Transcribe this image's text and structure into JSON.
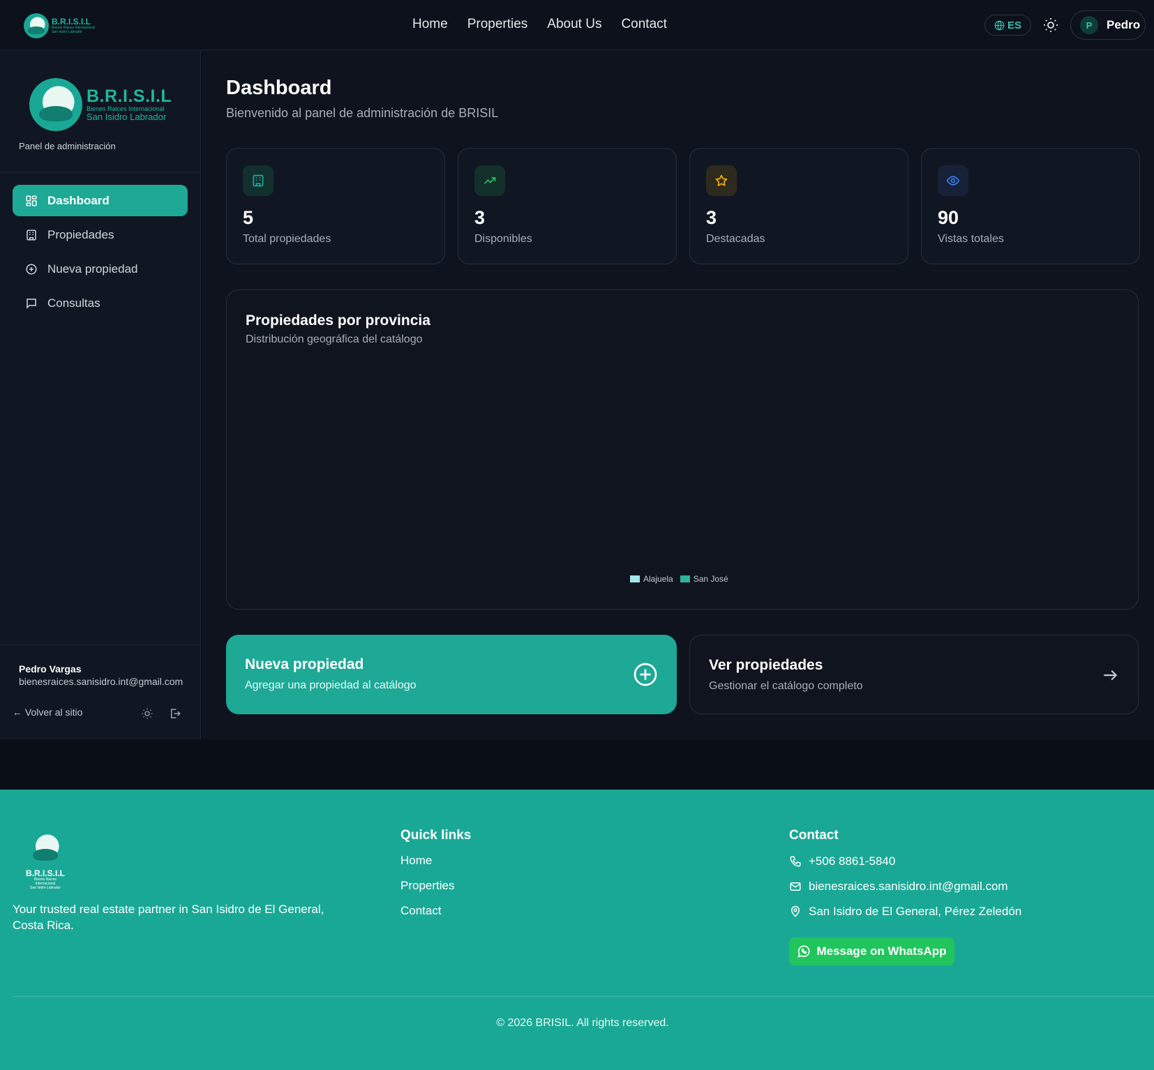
{
  "topnav": {
    "logo_brand": "B.R.I.S.I.L",
    "logo_line1": "Bienes Raices Internacional",
    "logo_line2": "San Isidro Labrador",
    "links": [
      "Home",
      "Properties",
      "About Us",
      "Contact"
    ],
    "lang": "ES",
    "user_initial": "P",
    "user_name": "Pedro"
  },
  "sidebar": {
    "brand": "B.R.I.S.I.L",
    "brand_line1": "Bienes Raices Internacional",
    "brand_line2": "San Isidro Labrador",
    "panel_label": "Panel de administración",
    "items": [
      {
        "label": "Dashboard",
        "icon": "dashboard-icon",
        "active": true
      },
      {
        "label": "Propiedades",
        "icon": "building-icon",
        "active": false
      },
      {
        "label": "Nueva propiedad",
        "icon": "plus-circle-icon",
        "active": false
      },
      {
        "label": "Consultas",
        "icon": "message-icon",
        "active": false
      }
    ],
    "user_name": "Pedro Vargas",
    "user_email": "bienesraices.sanisidro.int@gmail.com",
    "back_label": "← Volver al sitio"
  },
  "main": {
    "title": "Dashboard",
    "subtitle": "Bienvenido al panel de administración de BRISIL",
    "stats": [
      {
        "value": "5",
        "label": "Total propiedades",
        "icon": "building-icon",
        "color": "#1ea896",
        "bg": "#12302e"
      },
      {
        "value": "3",
        "label": "Disponibles",
        "icon": "trending-up-icon",
        "color": "#22c55e",
        "bg": "#13302a"
      },
      {
        "value": "3",
        "label": "Destacadas",
        "icon": "star-icon",
        "color": "#f5b400",
        "bg": "#2e2a1d"
      },
      {
        "value": "90",
        "label": "Vistas totales",
        "icon": "eye-icon",
        "color": "#3b82f6",
        "bg": "#172238"
      }
    ],
    "chart": {
      "title": "Propiedades por provincia",
      "subtitle": "Distribución geográfica del catálogo"
    },
    "actions": [
      {
        "title": "Nueva propiedad",
        "subtitle": "Agregar una propiedad al catálogo",
        "icon": "plus-circle-icon"
      },
      {
        "title": "Ver propiedades",
        "subtitle": "Gestionar el catálogo completo",
        "icon": "arrow-right-icon"
      }
    ]
  },
  "chart_data": {
    "type": "pie",
    "title": "Propiedades por provincia",
    "subtitle": "Distribución geográfica del catálogo",
    "series": [
      {
        "name": "Alajuela",
        "color": "#a5e6ec"
      },
      {
        "name": "San José",
        "color": "#2db39a"
      }
    ],
    "legend": "bottom-center"
  },
  "footer": {
    "brand": "B.R.I.S.I.L",
    "brand_line1": "Bienes Raices Internacional",
    "brand_line2": "San Isidro Labrador",
    "tagline": "Your trusted real estate partner in San Isidro de El General, Costa Rica.",
    "quick_links_title": "Quick links",
    "quick_links": [
      "Home",
      "Properties",
      "Contact"
    ],
    "contact_title": "Contact",
    "phone": "+506 8861-5840",
    "email": "bienesraices.sanisidro.int@gmail.com",
    "address": "San Isidro de El General, Pérez Zeledón",
    "whatsapp_label": "Message on WhatsApp",
    "copyright": "© 2026 BRISIL. All rights reserved."
  },
  "colors": {
    "accent": "#1ea896",
    "background": "#0e131d",
    "footer": "#1aa896",
    "whatsapp": "#21c55d"
  }
}
